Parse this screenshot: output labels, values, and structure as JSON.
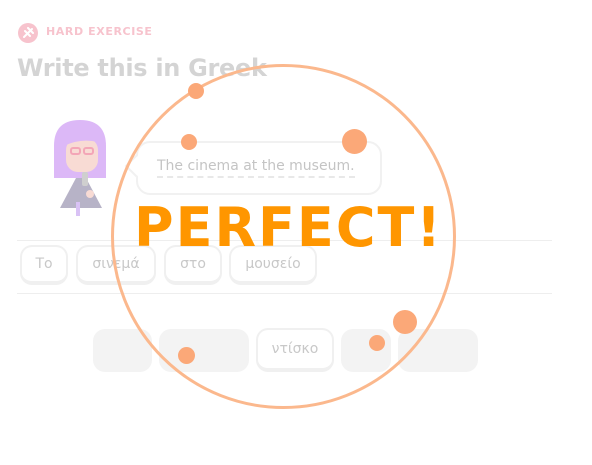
{
  "header": {
    "badge_label": "HARD EXERCISE",
    "title": "Write this in Greek"
  },
  "prompt": {
    "sentence": "The cinema at the museum."
  },
  "answer_tiles": [
    {
      "label": "Το"
    },
    {
      "label": "σινεμά"
    },
    {
      "label": "στο"
    },
    {
      "label": "μουσείο"
    }
  ],
  "word_bank": [
    {
      "label": "",
      "used": true
    },
    {
      "label": "",
      "used": true
    },
    {
      "label": "ντίσκο",
      "used": false
    },
    {
      "label": "",
      "used": true
    },
    {
      "label": "",
      "used": true
    }
  ],
  "feedback": {
    "message": "PERFECT!"
  },
  "colors": {
    "accent": "#ff9600",
    "ring": "#fbb88d",
    "badge": "#f7c3cd"
  }
}
